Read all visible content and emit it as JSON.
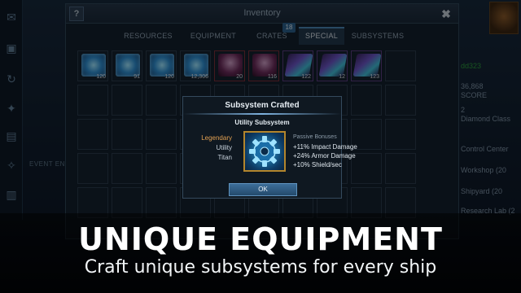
{
  "inventory": {
    "title": "Inventory",
    "help_label": "?",
    "close_label": "✖",
    "tabs": [
      {
        "label": "RESOURCES"
      },
      {
        "label": "EQUIPMENT"
      },
      {
        "label": "CRATES",
        "badge": "18"
      },
      {
        "label": "SPECIAL",
        "active": true
      },
      {
        "label": "SUBSYSTEMS"
      }
    ],
    "items": [
      {
        "kind": "blue",
        "count": "120"
      },
      {
        "kind": "blue",
        "count": "91"
      },
      {
        "kind": "blue",
        "count": "120"
      },
      {
        "kind": "blue",
        "count": "12,306"
      },
      {
        "kind": "red",
        "count": "20"
      },
      {
        "kind": "red",
        "count": "116"
      },
      {
        "kind": "card",
        "count": "122"
      },
      {
        "kind": "card",
        "count": "12"
      },
      {
        "kind": "card",
        "count": "123"
      }
    ]
  },
  "side": {
    "event_label": "EVENT EN",
    "right_texts": [
      "dd323",
      "36,868",
      "SCORE",
      "2",
      "Diamond Class",
      "Control Center",
      "Workshop (20",
      "Shipyard (20",
      "Research Lab (2"
    ]
  },
  "dialog": {
    "title": "Subsystem Crafted",
    "item_name": "Utility Subsystem",
    "rarity": "Legendary",
    "type": "Utility",
    "ship_class": "Titan",
    "passive_header": "Passive Bonuses",
    "bonuses": [
      "+11% Impact Damage",
      "+24% Armor Damage",
      "+10% Shield/sec"
    ],
    "ok_label": "OK",
    "icon": "gear-icon"
  },
  "banner": {
    "title": "UNIQUE EQUIPMENT",
    "subtitle": "Craft unique subsystems for every ship"
  },
  "colors": {
    "legendary": "#e2a052",
    "accent": "#4a86b5"
  }
}
